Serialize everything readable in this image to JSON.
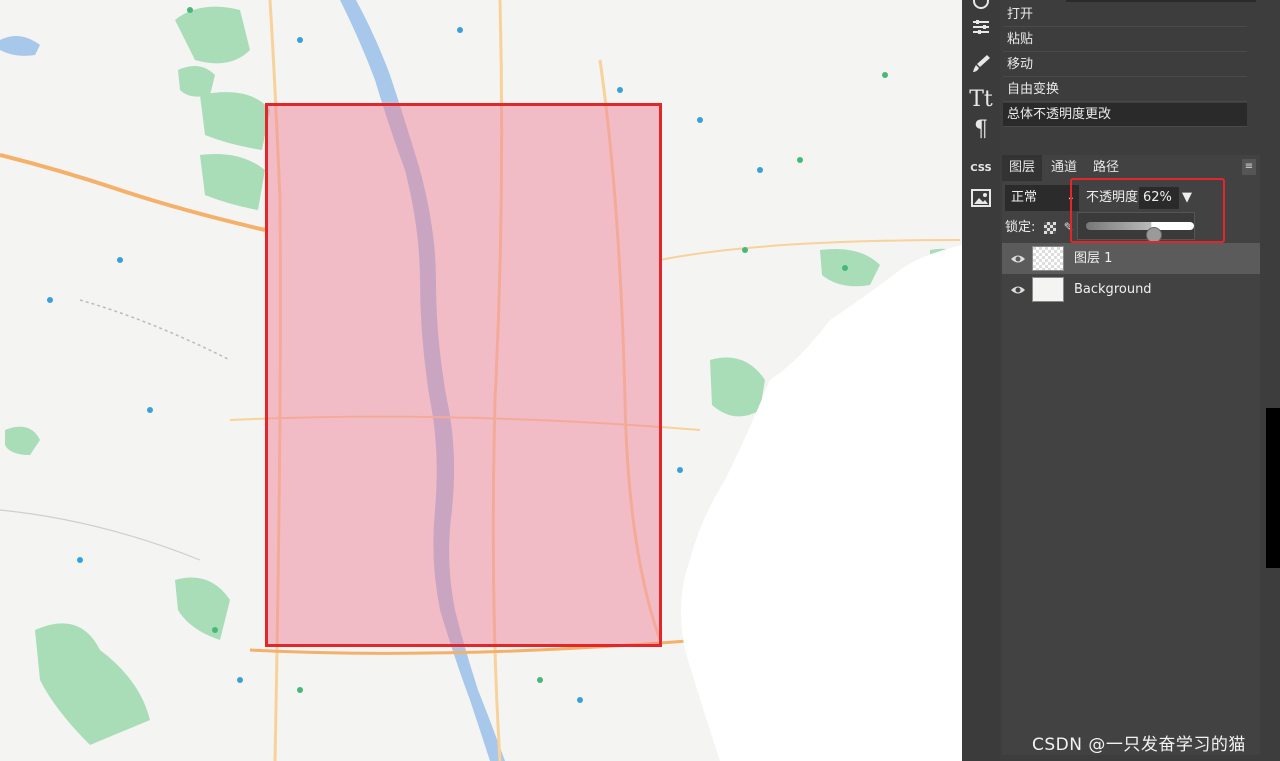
{
  "history": {
    "items": [
      "打开",
      "粘贴",
      "移动",
      "自由变换",
      "总体不透明度更改"
    ],
    "active_index": 4
  },
  "toolbar": {
    "tools": [
      "adjust-icon",
      "brush-icon",
      "text-icon",
      "paragraph-icon",
      "css-icon",
      "image-icon"
    ],
    "css_label": "CSS"
  },
  "layers_panel": {
    "tabs": [
      "图层",
      "通道",
      "路径"
    ],
    "active_tab": 0,
    "blend_mode": "正常",
    "opacity_label": "不透明度:",
    "opacity_value": "62%",
    "opacity_fraction": 0.62,
    "lock_label": "锁定:",
    "layers": [
      {
        "name": "图层 1",
        "visible": true,
        "selected": true
      },
      {
        "name": "Background",
        "visible": true,
        "selected": false
      }
    ]
  },
  "overlay": {
    "color": "#f08096",
    "border_color": "#e2262a"
  },
  "watermark": "CSDN @一只发奋学习的猫"
}
